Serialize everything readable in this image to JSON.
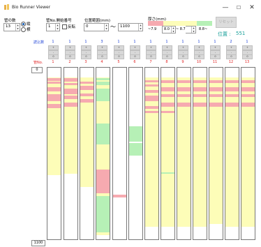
{
  "window": {
    "title": "Bio Runner Viewer",
    "minimize": "—",
    "maximize": "☐",
    "close": "✕"
  },
  "controls": {
    "tube_count_label": "管の数",
    "tube_count_value": "13",
    "orient_vertical": "縦",
    "orient_horizontal": "横",
    "start_no_label": "管No.開始番号",
    "start_no_value": "1",
    "reverse_label": "反転",
    "range_label": "位置範囲(mm)",
    "range_from": "0",
    "range_tilde": "〜",
    "range_to": "1100",
    "thick_label": "厚さ(mm)",
    "thick_v1": "~7.9",
    "thick_v2": "8.0",
    "thick_v3": "~ 8.7",
    "thick_v4": "8.8~",
    "reset_button": "リセット",
    "position_label": "位置 :",
    "position_value": "551"
  },
  "grid": {
    "col_header_label": "読込数",
    "tube_header_label": "管No.",
    "read_counts": [
      "1",
      "1",
      "1",
      "3",
      "1",
      "1",
      "1",
      "1",
      "1",
      "1",
      "1",
      "2",
      "1"
    ],
    "tube_numbers": [
      "1",
      "2",
      "3",
      "4",
      "5",
      "6",
      "7",
      "8",
      "9",
      "10",
      "11",
      "12",
      "13"
    ],
    "row_plus": "+",
    "row_minus": "-",
    "row_zero": "0",
    "scale_top": "0",
    "scale_bottom": "1100"
  },
  "colors": {
    "pink": "#f6aab0",
    "yellow": "#fdfdb8",
    "green": "#b6f0b6",
    "white": "#ffffff"
  }
}
